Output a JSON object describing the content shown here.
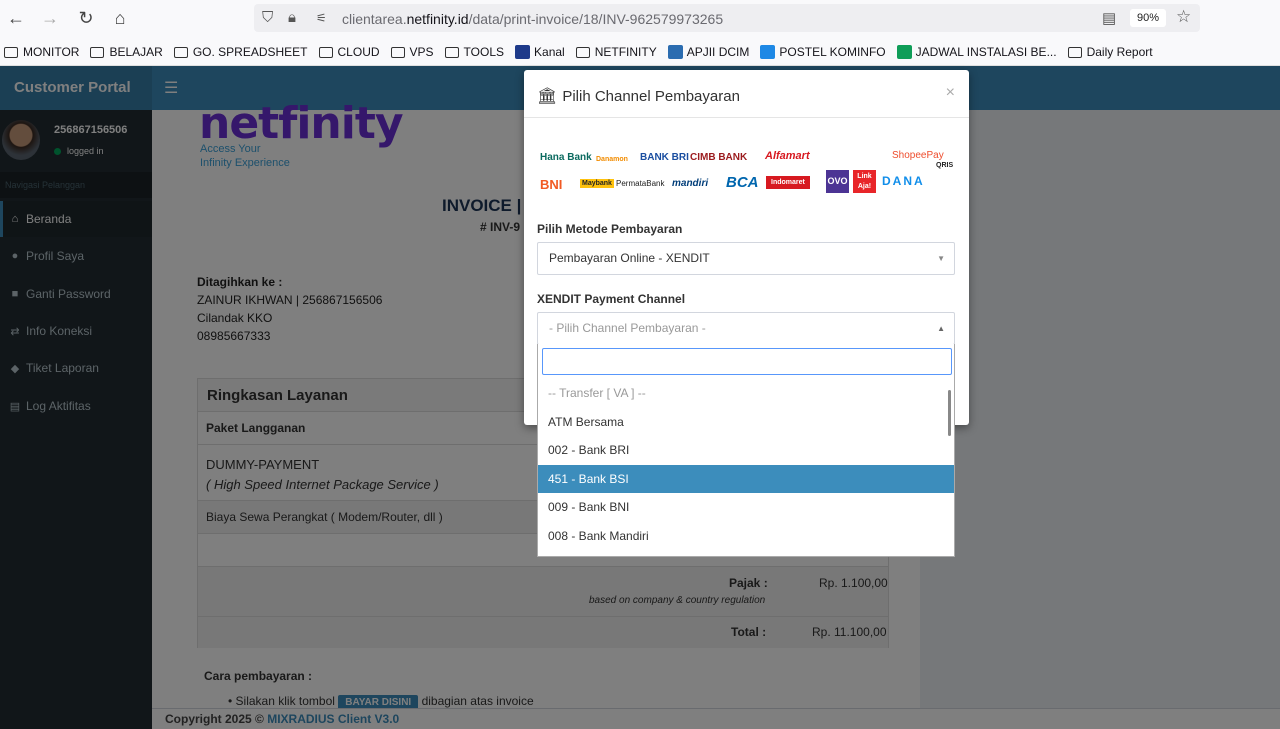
{
  "browser": {
    "url_prefix": "clientarea.",
    "url_domain": "netfinity.id",
    "url_path": "/data/print-invoice/18/INV-962579973265",
    "zoom": "90%",
    "bookmarks": [
      {
        "label": "MONITOR",
        "icon": "folder-icon"
      },
      {
        "label": "BELAJAR",
        "icon": "folder-icon"
      },
      {
        "label": "GO. SPREADSHEET",
        "icon": "folder-icon"
      },
      {
        "label": "CLOUD",
        "icon": "folder-icon"
      },
      {
        "label": "VPS",
        "icon": "folder-icon"
      },
      {
        "label": "TOOLS",
        "icon": "folder-icon"
      },
      {
        "label": "Kanal",
        "icon": "kanal-icon"
      },
      {
        "label": "NETFINITY",
        "icon": "folder-icon"
      },
      {
        "label": "APJII DCIM",
        "icon": "apjii-icon"
      },
      {
        "label": "POSTEL KOMINFO",
        "icon": "kominfo-icon"
      },
      {
        "label": "JADWAL INSTALASI BE...",
        "icon": "sheets-icon"
      },
      {
        "label": "Daily Report",
        "icon": "folder-icon"
      }
    ]
  },
  "app": {
    "brand": "Customer Portal",
    "user": {
      "id": "256867156506",
      "status": "logged in"
    },
    "nav_header": "Navigasi Pelanggan",
    "menu": [
      {
        "label": "Beranda",
        "icon": "home-icon",
        "glyph": "⌂"
      },
      {
        "label": "Profil Saya",
        "icon": "user-icon",
        "glyph": "●"
      },
      {
        "label": "Ganti Password",
        "icon": "lock-icon",
        "glyph": "■"
      },
      {
        "label": "Info Koneksi",
        "icon": "random-icon",
        "glyph": "⇄"
      },
      {
        "label": "Tiket Laporan",
        "icon": "tag-icon",
        "glyph": "◆"
      },
      {
        "label": "Log Aktifitas",
        "icon": "file-icon",
        "glyph": "▤"
      }
    ],
    "footer_prefix": "Copyright 2025 © ",
    "footer_link": "MIXRADIUS Client V3.0"
  },
  "invoice": {
    "brand": "netfinity",
    "tagline1": "Access Your",
    "tagline2": "Infinity Experience",
    "title": "INVOICE |",
    "number": "# INV-9",
    "billed_label": "Ditagihkan ke :",
    "billed_name": "ZAINUR IKHWAN | 256867156506",
    "billed_address": "Cilandak KKO",
    "billed_phone": "08985667333",
    "summary_title": "Ringkasan Layanan",
    "col_package": "Paket Langganan",
    "package_name": "DUMMY-PAYMENT",
    "package_desc": "( High Speed Internet Package Service )",
    "rental": "Biaya Sewa Perangkat ( Modem/Router, dll )",
    "tax_label": "Pajak :",
    "tax_note": "based on company & country regulation",
    "tax_value": "Rp. 1.100,00",
    "total_label": "Total :",
    "total_value": "Rp. 11.100,00",
    "payment_title": "Cara pembayaran :",
    "payment_step_prefix": "Silakan klik tombol",
    "payment_button": "BAYAR DISINI",
    "payment_step_suffix": "dibagian atas invoice"
  },
  "modal": {
    "title": "Pilih Channel Pembayaran",
    "method_label": "Pilih Metode Pembayaran",
    "method_value": "Pembayaran Online - XENDIT",
    "channel_label": "XENDIT Payment Channel",
    "channel_placeholder": "- Pilih Channel Pembayaran -",
    "search_value": "",
    "logos": {
      "hana": "Hana Bank",
      "danamon": "Danamon",
      "bri": "BANK BRI",
      "cimb": "CIMB BANK",
      "alfamart": "Alfamart",
      "shopeepay": "ShopeePay",
      "qris": "QRIS",
      "bni": "BNI",
      "maybank": "Maybank",
      "permata": "PermataBank",
      "mandiri": "mandiri",
      "bca": "BCA",
      "indomaret": "Indomaret",
      "ovo": "OVO",
      "linkaja": "Link Aja!",
      "dana": "DANA"
    },
    "options": [
      {
        "label": "-- Transfer [ VA ] --",
        "type": "group"
      },
      {
        "label": "ATM Bersama",
        "type": "option"
      },
      {
        "label": "002 - Bank BRI",
        "type": "option"
      },
      {
        "label": "451 - Bank BSI",
        "type": "highlighted"
      },
      {
        "label": "009 - Bank BNI",
        "type": "option"
      },
      {
        "label": "008 - Bank Mandiri",
        "type": "option"
      }
    ]
  }
}
